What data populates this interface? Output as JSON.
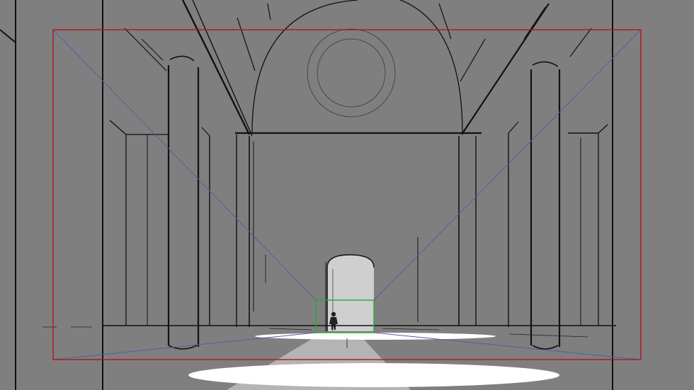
{
  "canvas": {
    "background": "#7f7f7f"
  },
  "palette": {
    "ink": "#111111",
    "thin_ink": "#2a2a2a",
    "camera_frame": "#b5141e",
    "focus_frame": "#1fae2c",
    "perspective_guide": "#5a5aa6",
    "light_beam": "#bdbdbd",
    "light_pool": "#ffffff",
    "doorway_light": "#cfcfcf"
  }
}
